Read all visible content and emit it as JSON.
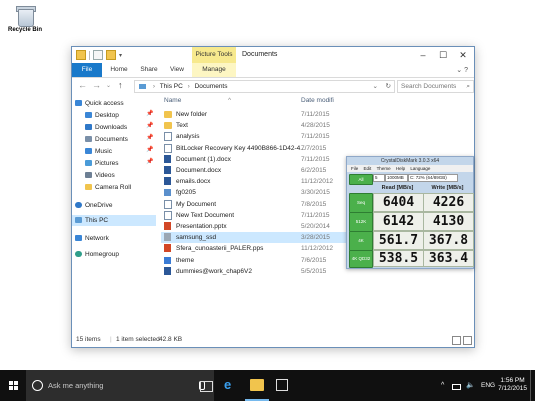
{
  "desktop": {
    "recycle_bin_label": "Recycle Bin"
  },
  "window": {
    "context_tab": "Picture Tools",
    "title": "Documents",
    "ribbon_tabs": [
      "File",
      "Home",
      "Share",
      "View",
      "Manage"
    ],
    "address": {
      "root": "This PC",
      "folder": "Documents"
    },
    "search_placeholder": "Search Documents",
    "columns": {
      "name": "Name",
      "date": "Date modifi"
    },
    "nav": {
      "quick_access": "Quick access",
      "items": [
        "Desktop",
        "Downloads",
        "Documents",
        "Music",
        "Pictures",
        "Videos",
        "Camera Roll"
      ],
      "onedrive": "OneDrive",
      "this_pc": "This PC",
      "network": "Network",
      "homegroup": "Homegroup"
    },
    "files": [
      {
        "name": "New folder",
        "date": "7/11/2015",
        "type": "folder"
      },
      {
        "name": "Text",
        "date": "4/28/2015",
        "type": "folder"
      },
      {
        "name": "analysis",
        "date": "7/11/2015",
        "type": "doc"
      },
      {
        "name": "BitLocker Recovery Key 4490B866-1D42-4...",
        "date": "7/7/2015",
        "type": "doc"
      },
      {
        "name": "Document (1).docx",
        "date": "7/11/2015",
        "type": "word"
      },
      {
        "name": "Document.docx",
        "date": "6/2/2015",
        "type": "word"
      },
      {
        "name": "emails.docx",
        "date": "11/12/2012",
        "type": "word"
      },
      {
        "name": "fg0205",
        "date": "3/30/2015",
        "type": "app"
      },
      {
        "name": "My Document",
        "date": "7/8/2015",
        "type": "doc"
      },
      {
        "name": "New Text Document",
        "date": "7/11/2015",
        "type": "doc"
      },
      {
        "name": "Presentation.pptx",
        "date": "5/20/2014",
        "type": "ppt"
      },
      {
        "name": "samsung_ssd",
        "date": "3/28/2015",
        "type": "sys"
      },
      {
        "name": "Sfera_cunoasterii_PALER.pps",
        "date": "11/12/2012",
        "type": "ppt"
      },
      {
        "name": "theme",
        "date": "7/6/2015",
        "type": "theme"
      },
      {
        "name": "dummies@work_chap6V2",
        "date": "5/5/2015",
        "type": "word"
      }
    ],
    "status": {
      "count": "15 items",
      "selected": "1 item selected",
      "size": "42.8 KB"
    }
  },
  "crystaldiskmark": {
    "title": "CrystalDiskMark 3.0.3 x64",
    "menu": [
      "File",
      "Edit",
      "Theme",
      "Help",
      "Language"
    ],
    "runs": "5",
    "size": "1000MB",
    "drive": "C: 72% (64/89GB)",
    "read_header": "Read [MB/s]",
    "write_header": "Write [MB/s]",
    "buttons": [
      "All",
      "Seq",
      "512K",
      "4K",
      "4K QD32"
    ],
    "rows": [
      {
        "read": "6404",
        "write": "4226"
      },
      {
        "read": "6142",
        "write": "4130"
      },
      {
        "read": "561.7",
        "write": "367.8"
      },
      {
        "read": "538.5",
        "write": "363.4"
      }
    ]
  },
  "taskbar": {
    "search_placeholder": "Ask me anything",
    "language": "ENG",
    "time": "1:56 PM",
    "date": "7/12/2015"
  },
  "colors": {
    "accent": "#1979ca",
    "selection": "#cce8ff",
    "cdm_green": "#4bb04b",
    "taskbar": "#101010"
  }
}
